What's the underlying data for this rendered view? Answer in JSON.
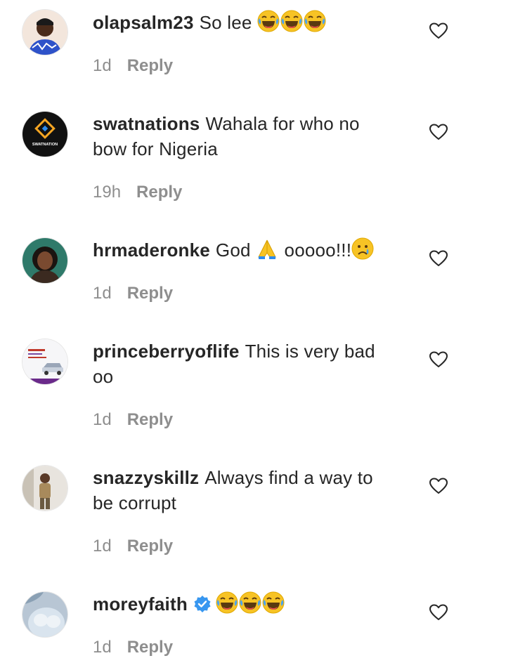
{
  "comments": [
    {
      "username": "olapsalm23",
      "text": "So lee",
      "emojis": [
        "laughing-tears",
        "laughing-tears",
        "laughing-tears"
      ],
      "time": "1d",
      "reply_label": "Reply"
    },
    {
      "username": "swatnations",
      "text": "Wahala for who no bow for Nigeria",
      "time": "19h",
      "reply_label": "Reply",
      "avatar_caption": "SWATNATION"
    },
    {
      "username": "hrmaderonke",
      "text_parts": [
        "God",
        "ooooo!!!"
      ],
      "emojis": [
        "folded-hands",
        "crying-face"
      ],
      "time": "1d",
      "reply_label": "Reply"
    },
    {
      "username": "princeberryoflife",
      "text": "This is very bad oo",
      "time": "1d",
      "reply_label": "Reply"
    },
    {
      "username": "snazzyskillz",
      "text": "Always find a way to be corrupt",
      "time": "1d",
      "reply_label": "Reply"
    },
    {
      "username": "moreyfaith",
      "verified": true,
      "emojis": [
        "laughing-tears",
        "laughing-tears",
        "laughing-tears"
      ],
      "time": "1d",
      "reply_label": "Reply"
    }
  ],
  "colors": {
    "text": "#262626",
    "meta": "#8e8e8e",
    "verified": "#3897f0",
    "emoji": "#f7c325"
  }
}
